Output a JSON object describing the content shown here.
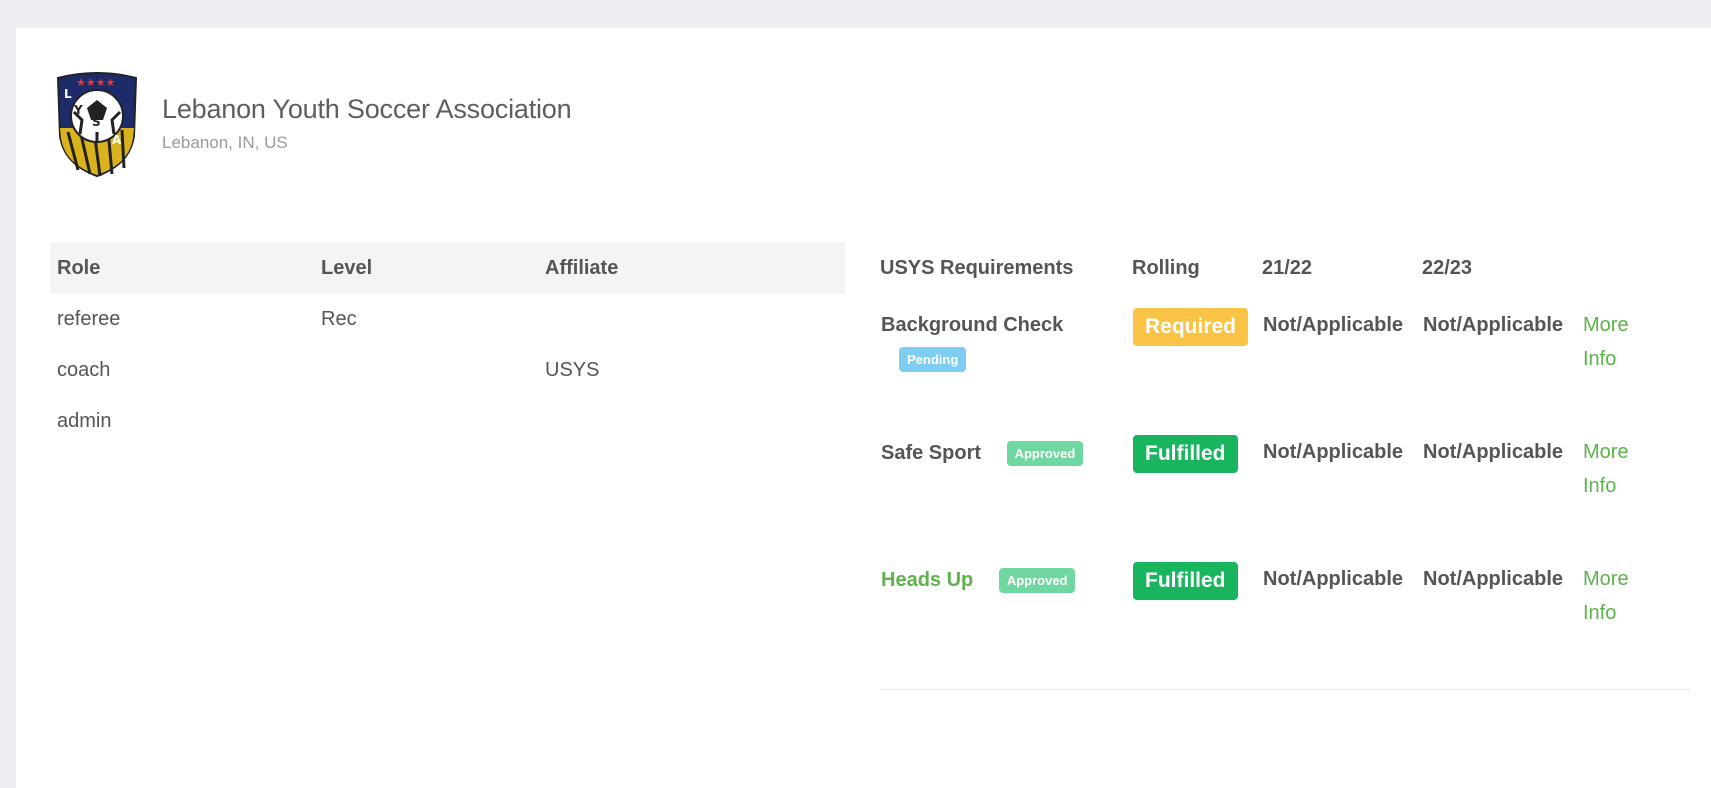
{
  "org": {
    "name": "Lebanon Youth Soccer Association",
    "location": "Lebanon, IN, US",
    "logo_letters": [
      "L",
      "Y",
      "S",
      "A"
    ]
  },
  "roles_table": {
    "headers": [
      "Role",
      "Level",
      "Affiliate"
    ],
    "rows": [
      {
        "role": "referee",
        "level": "Rec",
        "affiliate": ""
      },
      {
        "role": "coach",
        "level": "",
        "affiliate": "USYS"
      },
      {
        "role": "admin",
        "level": "",
        "affiliate": ""
      }
    ]
  },
  "requirements_table": {
    "headers": [
      "USYS Requirements",
      "Rolling",
      "21/22",
      "22/23"
    ],
    "rows": [
      {
        "name": "Background Check",
        "badge": "Pending",
        "status": "Required",
        "s2122": "Not/Applicable",
        "s2223": "Not/Applicable",
        "more": "More Info"
      },
      {
        "name": "Safe Sport",
        "badge": "Approved",
        "status": "Fulfilled",
        "s2122": "Not/Applicable",
        "s2223": "Not/Applicable",
        "more": "More Info"
      },
      {
        "name": "Heads Up",
        "badge": "Approved",
        "status": "Fulfilled",
        "s2122": "Not/Applicable",
        "s2223": "Not/Applicable",
        "more": "More Info"
      }
    ]
  },
  "colors": {
    "required": "#f9c445",
    "fulfilled": "#18b55e",
    "pending": "#7fcdf0",
    "approved": "#6fd8a1",
    "link_green": "#5cb34b"
  }
}
